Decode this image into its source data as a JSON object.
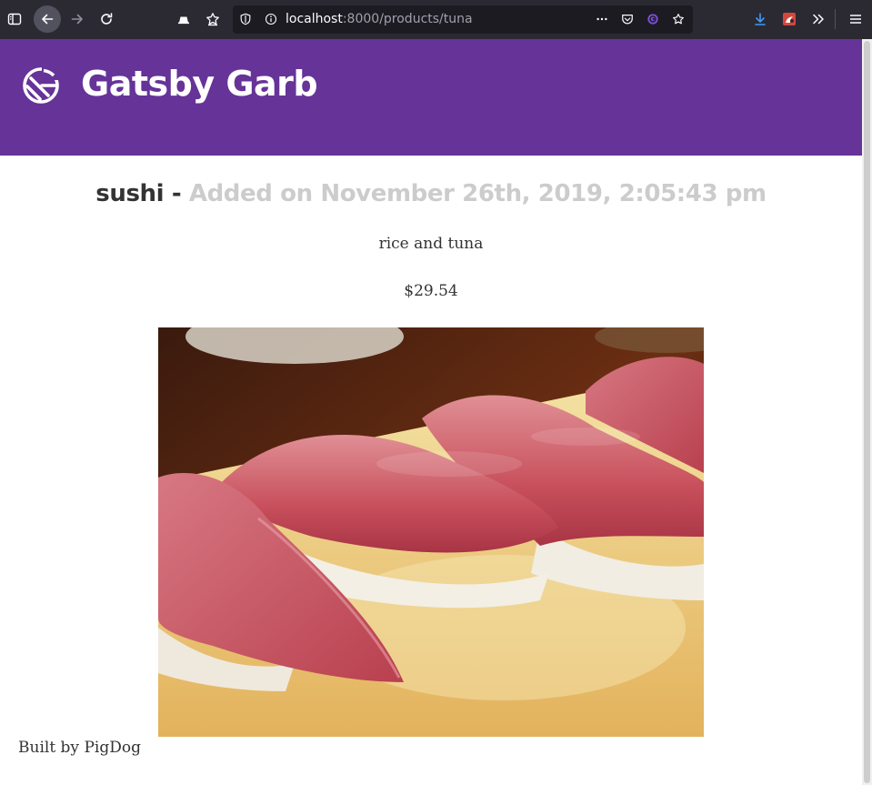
{
  "browser": {
    "url_host": "localhost",
    "url_path": ":8000/products/tuna"
  },
  "header": {
    "site_title": "Gatsby Garb",
    "brand_color": "#663399"
  },
  "product": {
    "name": "sushi",
    "separator": " - ",
    "added_on": "Added on November 26th, 2019, 2:05:43 pm",
    "description": "rice and tuna",
    "price": "$29.54",
    "image_alt": "sushi"
  },
  "footer": {
    "text": "Built by PigDog"
  }
}
